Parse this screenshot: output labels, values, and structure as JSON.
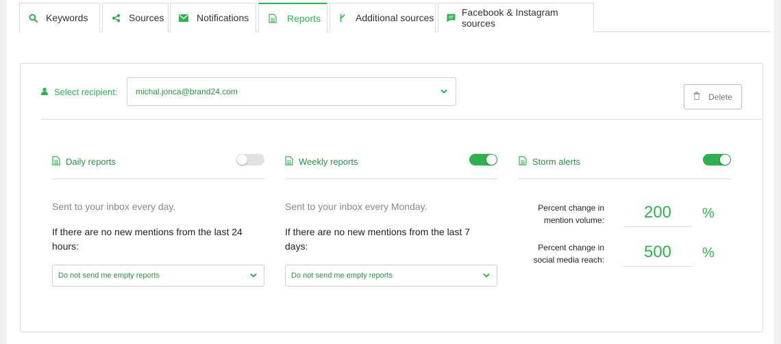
{
  "tabs": [
    {
      "label": "Keywords",
      "icon": "search-icon"
    },
    {
      "label": "Sources",
      "icon": "share-icon"
    },
    {
      "label": "Notifications",
      "icon": "envelope-icon"
    },
    {
      "label": "Reports",
      "icon": "document-icon",
      "active": true
    },
    {
      "label": "Additional sources",
      "icon": "fork-icon"
    },
    {
      "label": "Facebook & Instagram sources",
      "icon": "chat-icon"
    }
  ],
  "recipient": {
    "label": "Select recipient:",
    "value": "michal.jonca@brand24.com",
    "delete_label": "Delete"
  },
  "daily": {
    "title": "Daily reports",
    "enabled": false,
    "description": "Sent to your inbox every day.",
    "condition": "If there are no new mentions from the last 24 hours:",
    "empty_option": "Do not send me empty reports"
  },
  "weekly": {
    "title": "Weekly reports",
    "enabled": true,
    "description": "Sent to your inbox every Monday.",
    "condition": "If there are no new mentions from the last 7 days:",
    "empty_option": "Do not send me empty reports"
  },
  "storm": {
    "title": "Storm alerts",
    "enabled": true,
    "volume_label": "Percent change in mention volume:",
    "volume_value": "200",
    "reach_label": "Percent change in social media reach:",
    "reach_value": "500",
    "unit": "%"
  },
  "colors": {
    "accent": "#2db24d",
    "accent_text": "#2a8f41"
  }
}
